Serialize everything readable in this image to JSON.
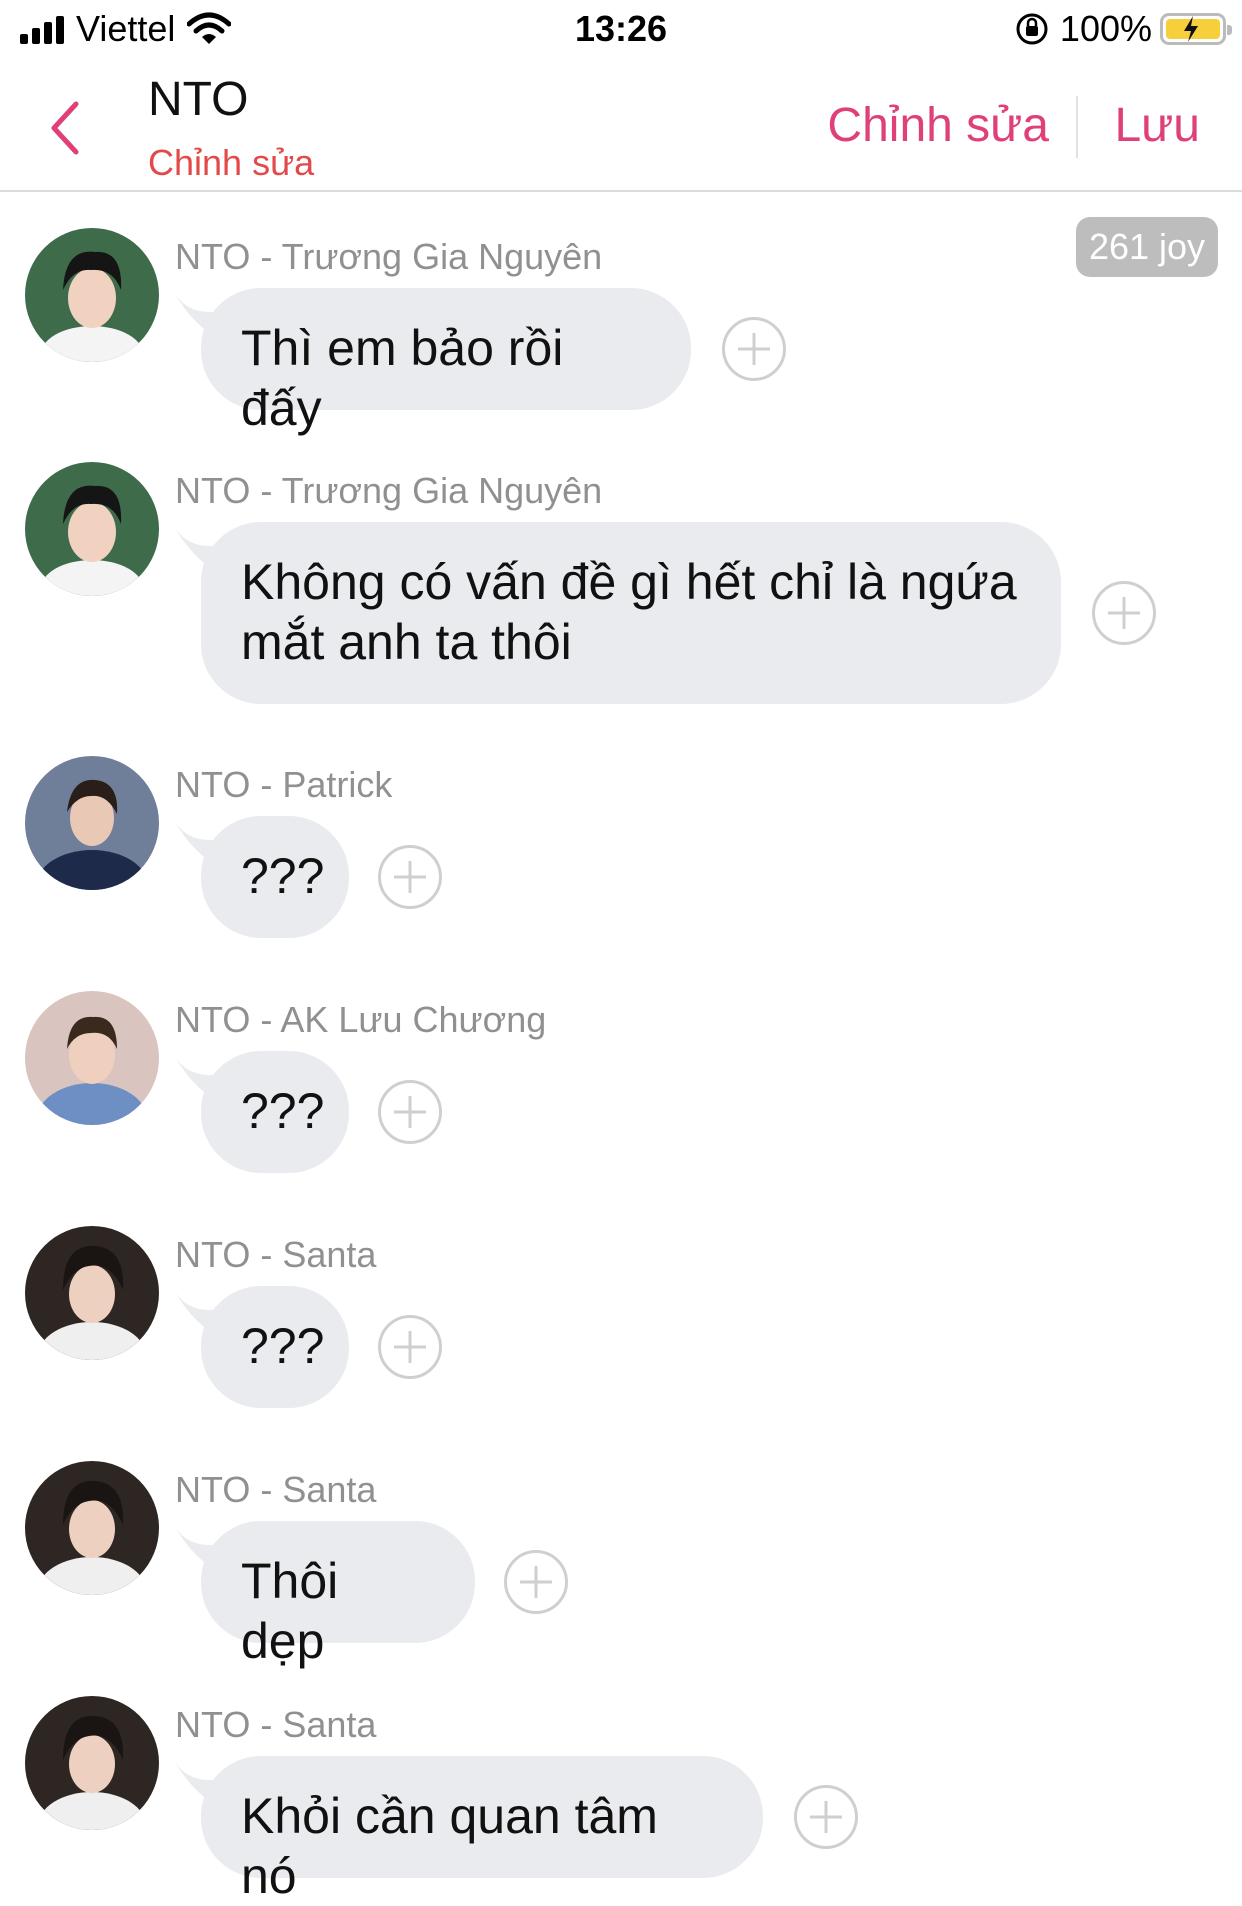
{
  "status_bar": {
    "carrier": "Viettel",
    "time": "13:26",
    "battery": "100%"
  },
  "header": {
    "title": "NTO",
    "subtitle": "Chỉnh sửa",
    "edit_label": "Chỉnh sửa",
    "save_label": "Lưu"
  },
  "joy_badge": "261 joy",
  "messages": [
    {
      "sender": "NTO - Trương Gia Nguyên",
      "text": "Thì em bảo rồi đấy"
    },
    {
      "sender": "NTO - Trương Gia Nguyên",
      "text": "Không có vấn đề gì hết chỉ là ngứa mắt anh ta thôi"
    },
    {
      "sender": "NTO - Patrick",
      "text": "???"
    },
    {
      "sender": "NTO - AK Lưu Chương",
      "text": "???"
    },
    {
      "sender": "NTO - Santa",
      "text": "???"
    },
    {
      "sender": "NTO - Santa",
      "text": "Thôi dẹp"
    },
    {
      "sender": "NTO - Santa",
      "text": "Khỏi cần quan tâm nó"
    }
  ],
  "colors": {
    "accent": "#e0407a",
    "subtitle": "#e24a4a",
    "bubble": "#e9ebee"
  }
}
